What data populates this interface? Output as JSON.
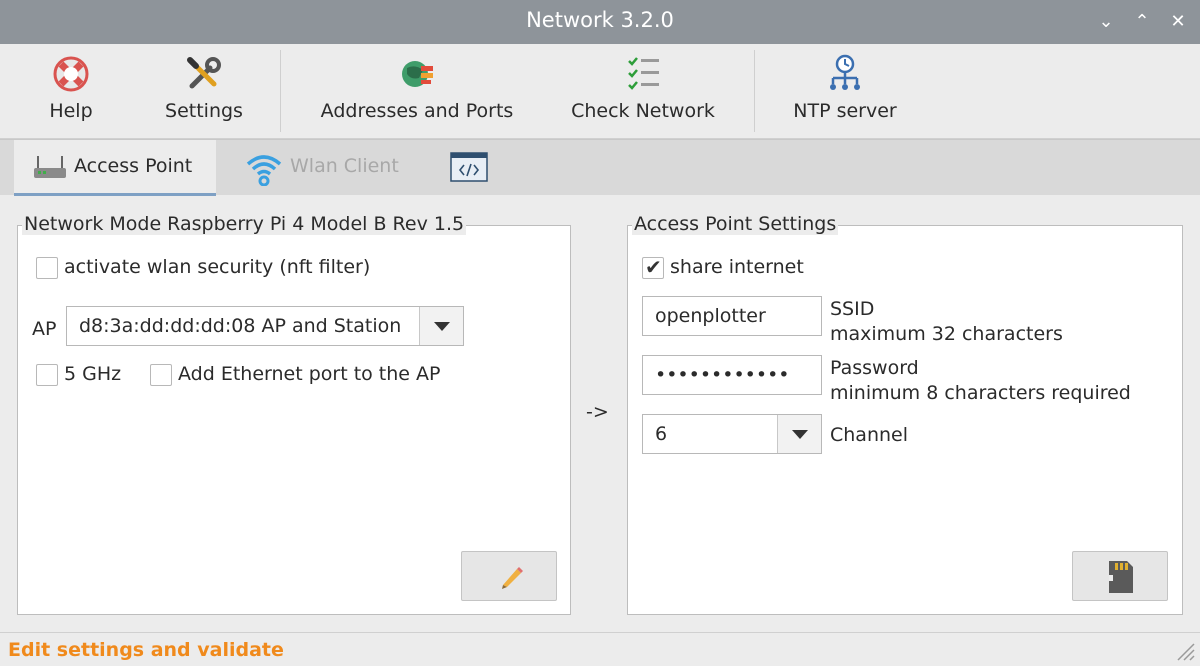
{
  "window": {
    "title": "Network 3.2.0",
    "controls": {
      "minimize": "⌄",
      "maximize": "⌃",
      "close": "✕"
    }
  },
  "toolbar": {
    "help": "Help",
    "settings": "Settings",
    "addresses": "Addresses and Ports",
    "check": "Check Network",
    "ntp": "NTP server"
  },
  "tabs": {
    "access_point": "Access Point",
    "wlan_client": "Wlan Client"
  },
  "network_mode": {
    "legend": "Network Mode  Raspberry Pi 4 Model B Rev 1.5",
    "security_label": "activate wlan security (nft filter)",
    "security_checked": false,
    "ap_label": "AP",
    "ap_value": "d8:3a:dd:dd:dd:08 AP and Station",
    "ghz_label": "5 GHz",
    "ghz_checked": false,
    "eth_label": "Add Ethernet port to the AP",
    "eth_checked": false
  },
  "arrow_label": "->",
  "ap_settings": {
    "legend": "Access Point Settings",
    "share_label": "share internet",
    "share_checked": true,
    "ssid_value": "openplotter",
    "ssid_label": "SSID",
    "ssid_hint": "maximum 32 characters",
    "password_value": "••••••••••••",
    "password_label": "Password",
    "password_hint": "minimum 8 characters required",
    "channel_value": "6",
    "channel_label": "Channel"
  },
  "status": {
    "message": "Edit settings and validate"
  },
  "colors": {
    "status_text": "#f08a1c",
    "titlebar": "#8e949a",
    "tab_active_underline": "#7ea0c4"
  }
}
